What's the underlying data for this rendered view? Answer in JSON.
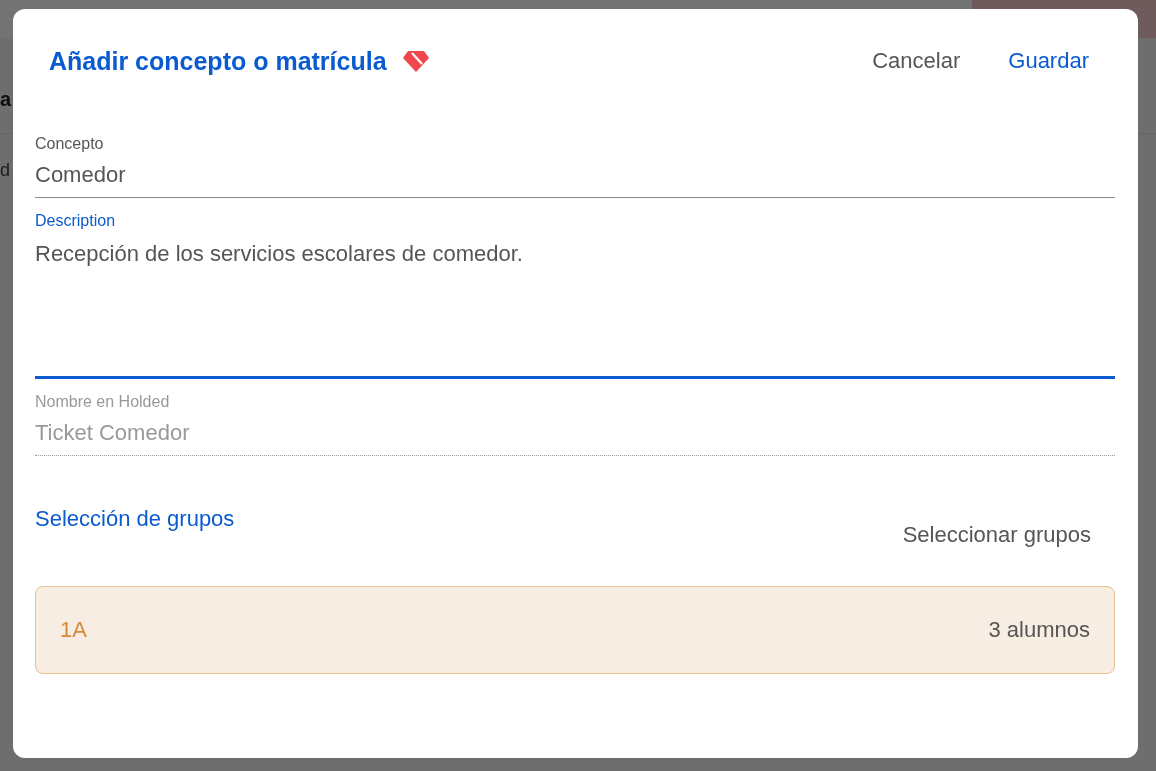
{
  "background": {
    "heading_fragment": "a",
    "text_fragment": "d"
  },
  "dialog": {
    "title": "Añadir concepto o matrícula",
    "actions": [
      {
        "label": "Cancelar",
        "kind": "secondary"
      },
      {
        "label": "Guardar",
        "kind": "primary"
      }
    ],
    "fields": [
      {
        "label": "Concepto",
        "value": "Comedor",
        "kind": "line",
        "focused": false,
        "disabled": false
      },
      {
        "label": "Description",
        "value": "Recepción de los servicios escolares de comedor.",
        "kind": "area",
        "focused": true,
        "disabled": false
      },
      {
        "label": "Nombre en Holded",
        "value": "Ticket Comedor",
        "kind": "line",
        "focused": false,
        "disabled": true
      }
    ],
    "groups_section": {
      "title": "Selección de grupos",
      "action": "Seleccionar grupos",
      "groups": [
        {
          "name": "1A",
          "count": "3 alumnos"
        }
      ]
    }
  }
}
